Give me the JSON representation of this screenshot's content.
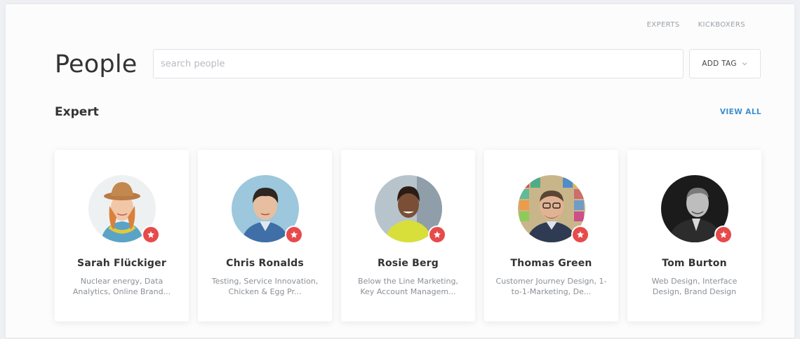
{
  "topnav": {
    "items": [
      "EXPERTS",
      "KICKBOXERS"
    ]
  },
  "header": {
    "title": "People",
    "search_placeholder": "search people",
    "add_tag_label": "ADD TAG"
  },
  "section": {
    "title": "Expert",
    "view_all": "VIEW ALL"
  },
  "people": [
    {
      "name": "Sarah Flückiger",
      "tags": "Nuclear energy, Data Analytics, Online Brand..."
    },
    {
      "name": "Chris Ronalds",
      "tags": "Testing, Service Innovation, Chicken & Egg Pr..."
    },
    {
      "name": "Rosie Berg",
      "tags": "Below the Line Marketing, Key Account Managem..."
    },
    {
      "name": "Thomas Green",
      "tags": "Customer Journey Design, 1-to-1-Marketing, De..."
    },
    {
      "name": "Tom Burton",
      "tags": "Web Design, Interface Design, Brand Design"
    }
  ],
  "colors": {
    "accent": "#3e8ed0",
    "badge": "#e74a4a"
  }
}
